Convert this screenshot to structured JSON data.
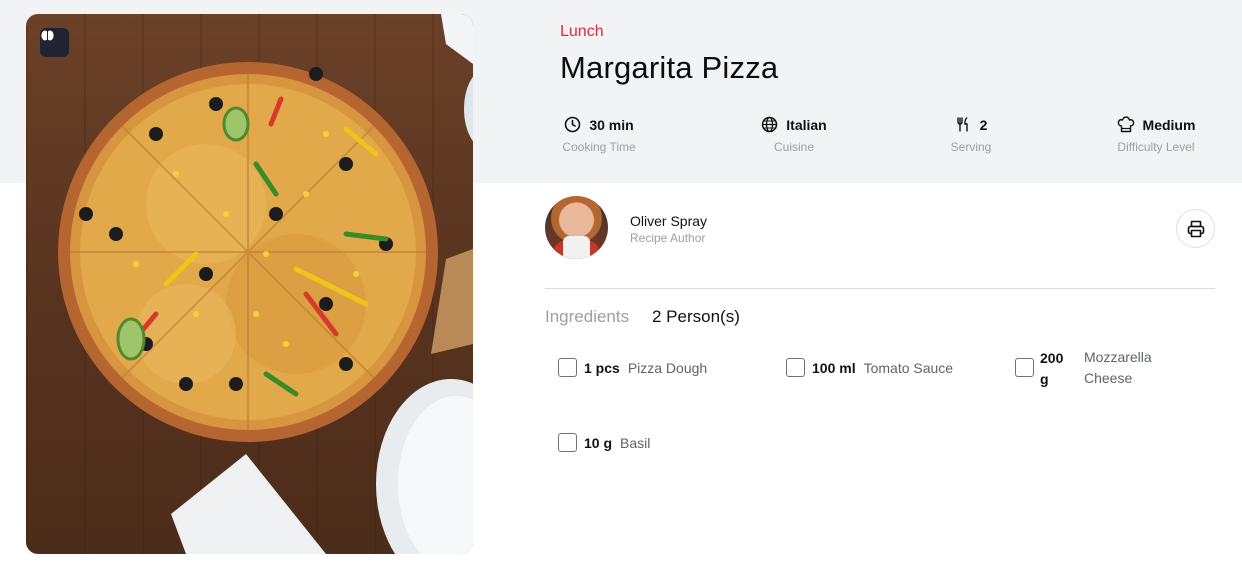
{
  "recipe": {
    "category": "Lunch",
    "title": "Margarita Pizza",
    "accent_color": "#e8283f"
  },
  "meta": {
    "time": {
      "value": "30 min",
      "label": "Cooking Time",
      "icon": "clock-icon"
    },
    "cuisine": {
      "value": "Italian",
      "label": "Cuisine",
      "icon": "globe-icon"
    },
    "serving": {
      "value": "2",
      "label": "Serving",
      "icon": "utensils-icon"
    },
    "difficulty": {
      "value": "Medium",
      "label": "Difficulty Level",
      "icon": "chef-hat-icon"
    }
  },
  "author": {
    "name": "Oliver Spray",
    "role": "Recipe Author"
  },
  "actions": {
    "print_icon": "printer-icon"
  },
  "ingredients": {
    "heading": "Ingredients",
    "servings": "2 Person(s)",
    "items": [
      {
        "qty": "1 pcs",
        "name": "Pizza Dough"
      },
      {
        "qty": "100 ml",
        "name": "Tomato Sauce"
      },
      {
        "qty": "200 g",
        "name": "Mozzarella Cheese"
      },
      {
        "qty": "10 g",
        "name": "Basil"
      }
    ]
  }
}
